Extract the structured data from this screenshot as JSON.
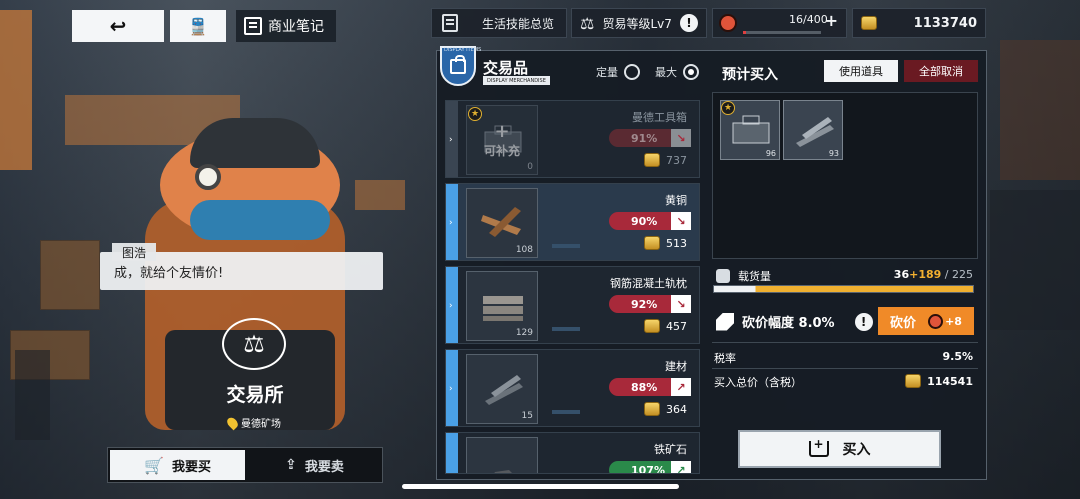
{
  "nav": {
    "back_icon": "↩",
    "train_icon": "🚆",
    "notes_label": "商业笔记"
  },
  "top_bar": {
    "skills_label": "生活技能总览",
    "trade_level": "贸易等级Lv7",
    "excl": "!",
    "stamina": "16/400",
    "stamina_plus": "+",
    "stamina_fraction": 0.04,
    "money": "1133740"
  },
  "dialog": {
    "speaker": "图浩",
    "text": "成，就给个友情价!"
  },
  "exchange": {
    "title": "交易所",
    "location": "曼德矿场"
  },
  "tabs": {
    "buy": "我要买",
    "sell": "我要卖"
  },
  "panel": {
    "tag_small": "DISPLAY ITEMS",
    "title": "交易品",
    "sub": "DISPLAY MERCHANDISE",
    "mode_fixed": "定量",
    "mode_max": "最大"
  },
  "items": [
    {
      "name": "曼德工具箱",
      "pct": "91%",
      "price": "737",
      "qty": "0",
      "overlay_plus": "+",
      "overlay_label": "可补充"
    },
    {
      "name": "黄铜",
      "pct": "90%",
      "price": "513",
      "qty": "108"
    },
    {
      "name": "钢筋混凝土轨枕",
      "pct": "92%",
      "price": "457",
      "qty": "129"
    },
    {
      "name": "建材",
      "pct": "88%",
      "price": "364",
      "qty": "15"
    },
    {
      "name": "铁矿石",
      "pct": "107%",
      "price": "",
      "qty": ""
    }
  ],
  "basket": {
    "title": "预计买入",
    "use_item": "使用道具",
    "cancel_all": "全部取消",
    "items": [
      {
        "qty": "96"
      },
      {
        "qty": "93"
      }
    ]
  },
  "cargo": {
    "label": "载货量",
    "current": "36",
    "add": "+189",
    "sep": " / ",
    "total": "225"
  },
  "bargain": {
    "label": "砍价幅度 8.0%",
    "excl": "!",
    "button": "砍价",
    "cost": "+8"
  },
  "tax": {
    "label": "税率",
    "value": "9.5%"
  },
  "total": {
    "label": "买入总价（含税）",
    "value": "114541"
  },
  "buy_button": "买入",
  "colors": {
    "accent_blue": "#4aa0e6",
    "price_red": "#a8293a",
    "cargo_gold": "#f0b030",
    "bargain_orange": "#f08a28"
  }
}
